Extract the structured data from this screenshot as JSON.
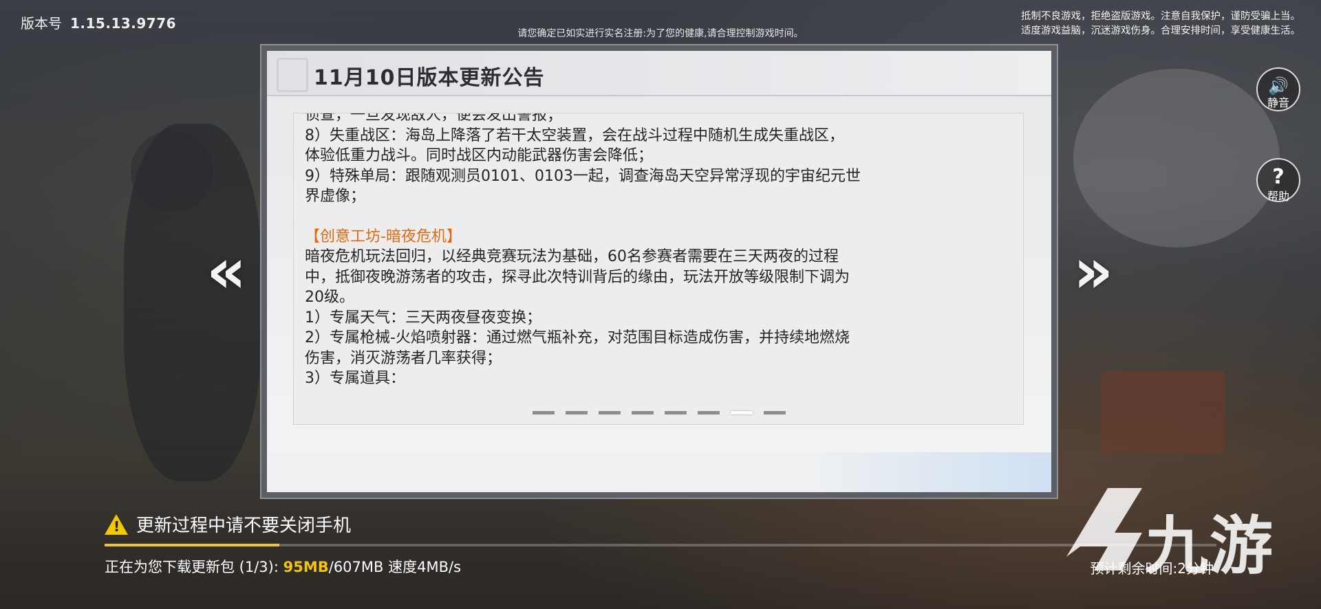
{
  "header": {
    "version_label": "版本号",
    "version_number": "1.15.13.9776",
    "top_notice": "请您确定已如实进行实名注册:为了您的健康,请合理控制游戏时间。",
    "health_line1": "抵制不良游戏，拒绝盗版游戏。注意自我保护，谨防受骗上当。",
    "health_line2": "适度游戏益脑，沉迷游戏伤身。合理安排时间，享受健康生活。"
  },
  "announcement": {
    "title": "11月10日版本更新公告",
    "lines": [
      "侦查，一旦发现敌人，便会发出警报；",
      "8）失重战区：海岛上降落了若干太空装置，会在战斗过程中随机生成失重战区，",
      "体验低重力战斗。同时战区内动能武器伤害会降低；",
      "9）特殊单局：跟随观测员0101、0103一起，调查海岛天空异常浮现的宇宙纪元世",
      "界虚像；"
    ],
    "section_title": "【创意工坊-暗夜危机】",
    "section_lines": [
      "暗夜危机玩法回归，以经典竞赛玩法为基础，60名参赛者需要在三天两夜的过程",
      "中，抵御夜晚游荡者的攻击，探寻此次特训背后的缘由，玩法开放等级限制下调为",
      "20级。",
      "1）专属天气：三天两夜昼夜变换；",
      "2）专属枪械-火焰喷射器：通过燃气瓶补充，对范围目标造成伤害，并持续地燃烧",
      "伤害，消灭游荡者几率获得；",
      "3）专属道具："
    ],
    "page_count": 8,
    "active_page": 7
  },
  "nav": {
    "prev_icon": "double-chevron-left-icon",
    "next_icon": "double-chevron-right-icon",
    "prev_glyph": "«",
    "next_glyph": "»"
  },
  "side_buttons": {
    "mute_glyph": "🔊",
    "mute_label": "静音",
    "help_glyph": "?",
    "help_label": "帮助"
  },
  "update": {
    "warning": "更新过程中请不要关闭手机",
    "download_prefix": "正在为您下载更新包 (1/3): ",
    "downloaded": "95MB",
    "total": "/607MB",
    "speed": " 速度4MB/s",
    "remaining": "预计剩余时间:2分钟",
    "progress_fraction": 0.157
  },
  "watermark": {
    "text": "九游"
  },
  "colors": {
    "accent_orange": "#e06a12",
    "progress_yellow": "#f2c21a",
    "warning_yellow": "#f3c800"
  }
}
